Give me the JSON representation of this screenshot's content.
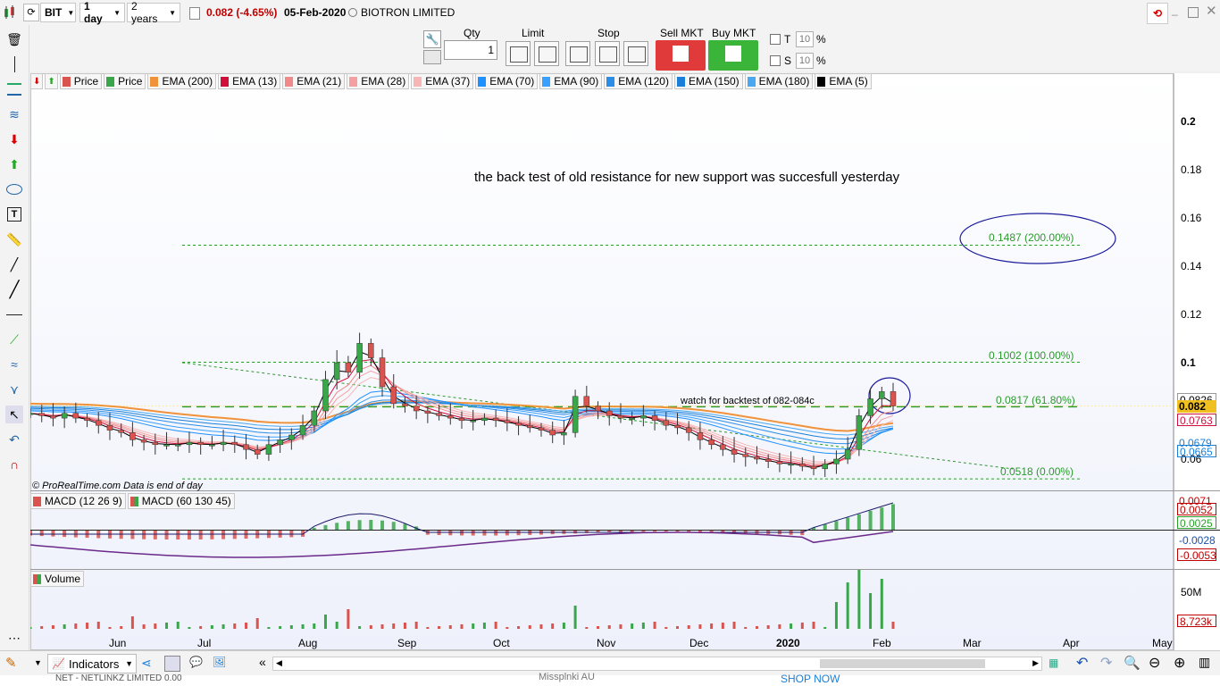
{
  "toolbar": {
    "symbol": "BIT",
    "interval": "1 day",
    "range": "2 years",
    "price_change": "0.082 (-4.65%)",
    "date": "05-Feb-2020",
    "company": "BIOTRON LIMITED"
  },
  "order": {
    "qty_label": "Qty",
    "qty_value": "1",
    "limit_label": "Limit",
    "stop_label": "Stop",
    "sell_label": "Sell MKT",
    "buy_label": "Buy MKT",
    "t_label": "T",
    "s_label": "S",
    "t_value": "10",
    "s_value": "10",
    "pct": "%"
  },
  "legend": [
    {
      "label": "Price",
      "color": "#d9534f"
    },
    {
      "label": "Price",
      "color": "#3aa64a"
    },
    {
      "label": "EMA (200)",
      "color": "#f0923a"
    },
    {
      "label": "EMA (13)",
      "color": "#d0103a"
    },
    {
      "label": "EMA (21)",
      "color": "#f08a8a"
    },
    {
      "label": "EMA (28)",
      "color": "#f4a0a0"
    },
    {
      "label": "EMA (37)",
      "color": "#f7b5b5"
    },
    {
      "label": "EMA (70)",
      "color": "#1e90ff"
    },
    {
      "label": "EMA (90)",
      "color": "#3aa0ff"
    },
    {
      "label": "EMA (120)",
      "color": "#2a8ee8"
    },
    {
      "label": "EMA (150)",
      "color": "#1a7fd8"
    },
    {
      "label": "EMA (180)",
      "color": "#4aa8f0"
    },
    {
      "label": "EMA (5)",
      "color": "#000000"
    }
  ],
  "annotations": {
    "headline": "the back test of old resistance for new support was succesfull yesterday",
    "watch": "watch for backtest of 082-084c",
    "fib_200": "0.1487 (200.00%)",
    "fib_100": "0.1002 (100.00%)",
    "fib_618": "0.0817 (61.80%)",
    "fib_0": "0.0518 (0.00%)",
    "source": "© ProRealTime.com  Data is end of day"
  },
  "price_axis": {
    "ticks": [
      "0.2",
      "0.18",
      "0.16",
      "0.14",
      "0.12",
      "0.1",
      "0.06"
    ],
    "tags": [
      {
        "text": "0.0826",
        "color": "#ffffff",
        "textcolor": "#000000"
      },
      {
        "text": "0.082",
        "color": "#f0c020",
        "textcolor": "#000000"
      },
      {
        "text": "0.0763",
        "color": "#ffffff",
        "textcolor": "#d0103a"
      },
      {
        "text": "0.0679",
        "color": "#ffffff",
        "textcolor": "#1a7fd8"
      },
      {
        "text": "0.0665",
        "color": "#ffffff",
        "textcolor": "#1a7fd8"
      }
    ]
  },
  "macd": {
    "legend1": "MACD (12 26 9)",
    "legend2": "MACD (60 130 45)",
    "tags": [
      {
        "text": "0.0071",
        "textcolor": "#c00000"
      },
      {
        "text": "0.0052",
        "textcolor": "#c00000"
      },
      {
        "text": "0.0025",
        "textcolor": "#2aa02a"
      },
      {
        "text": "-0.0028",
        "textcolor": "#1a50b0"
      },
      {
        "text": "-0.0053",
        "textcolor": "#c00000"
      }
    ]
  },
  "volume": {
    "legend": "Volume",
    "tick": "50M",
    "tag": "8,723k"
  },
  "months": [
    "Jun",
    "Jul",
    "Aug",
    "Sep",
    "Oct",
    "Nov",
    "Dec",
    "2020",
    "Feb",
    "Mar",
    "Apr",
    "May"
  ],
  "bottom": {
    "indicators": "Indicators",
    "strip_text1": "NET - NETLINKZ LIMITED 0.00",
    "strip_text2": "Missplnki AU",
    "strip_text3": "SHOP NOW"
  },
  "chart_data": {
    "type": "candlestick",
    "ylim": [
      0.045,
      0.21
    ],
    "fib_levels": [
      0.1487,
      0.1002,
      0.0817,
      0.0518
    ],
    "close_approx": [
      0.079,
      0.078,
      0.077,
      0.079,
      0.077,
      0.076,
      0.074,
      0.072,
      0.071,
      0.068,
      0.067,
      0.066,
      0.066,
      0.066,
      0.067,
      0.066,
      0.066,
      0.067,
      0.066,
      0.064,
      0.062,
      0.066,
      0.068,
      0.07,
      0.074,
      0.08,
      0.093,
      0.1,
      0.096,
      0.108,
      0.102,
      0.09,
      0.083,
      0.082,
      0.08,
      0.079,
      0.078,
      0.077,
      0.076,
      0.076,
      0.077,
      0.076,
      0.075,
      0.074,
      0.073,
      0.072,
      0.07,
      0.071,
      0.086,
      0.082,
      0.08,
      0.078,
      0.077,
      0.077,
      0.078,
      0.076,
      0.074,
      0.073,
      0.071,
      0.068,
      0.066,
      0.064,
      0.062,
      0.061,
      0.06,
      0.059,
      0.058,
      0.058,
      0.057,
      0.056,
      0.058,
      0.06,
      0.064,
      0.078,
      0.085,
      0.088,
      0.082
    ]
  }
}
